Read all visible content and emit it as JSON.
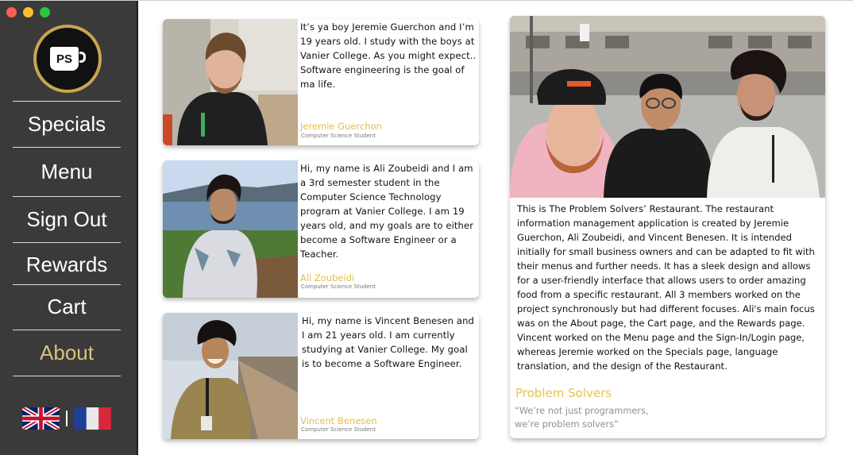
{
  "window": {
    "controls": [
      "close",
      "minimize",
      "maximize"
    ]
  },
  "brand": {
    "logo_text": "PS",
    "logo_icon": "coffee-mug-icon",
    "colors": {
      "gold": "#c9a54f",
      "sidebar": "#3a3a3a",
      "active": "#d8c27e"
    }
  },
  "nav": {
    "items": [
      {
        "label": "Specials"
      },
      {
        "label": "Menu"
      },
      {
        "label": "Sign Out"
      },
      {
        "label": "Rewards"
      },
      {
        "label": "Cart"
      },
      {
        "label": "About"
      }
    ],
    "active": "About"
  },
  "language": {
    "options": [
      "uk-flag-icon",
      "france-flag-icon"
    ],
    "separator": "|"
  },
  "members": [
    {
      "bio": "It’s ya boy Jeremie Guerchon and I’m 19 years old. I study with the boys at Vanier College. As you might expect.. Software engineering is the goal of ma life.",
      "name": "Jeremie Guerchon",
      "role": "Computer Science Student"
    },
    {
      "bio": "Hi, my name is Ali Zoubeidi and I am a 3rd semester student in the Computer Science Technology program at Vanier College. I am 19 years old, and my goals are to either become a Software Engineer or a Teacher.",
      "name": "Ali Zoubeidi",
      "role": "Computer Science Student"
    },
    {
      "bio": "Hi, my name is Vincent Benesen and I am 21 years old. I am currently studying at Vanier College. My goal is to become a Software Engineer.",
      "name": "Vincent Benesen",
      "role": "Computer Science Student"
    }
  ],
  "about": {
    "text": "This is The Problem Solvers’ Restaurant. The restaurant information management application is created by Jeremie Guerchon, Ali Zoubeidi, and Vincent Benesen. It is intended initially for small business owners and can be adapted to fit with their menus and further needs. It has a sleek design and allows for a user-friendly interface that allows users to order amazing food from a specific restaurant. All 3 members worked on the project synchronously but had different focuses. Ali's main focus was on the About page, the Cart page, and the Rewards page. Vincent worked on the Menu page and the Sign-In/Login page, whereas Jeremie worked on the Specials page, language translation, and the design of the Restaurant.",
    "team_name": "Problem Solvers",
    "tagline_line1": "“We’re not just programmers,",
    "tagline_line2": "we’re problem solvers”"
  }
}
